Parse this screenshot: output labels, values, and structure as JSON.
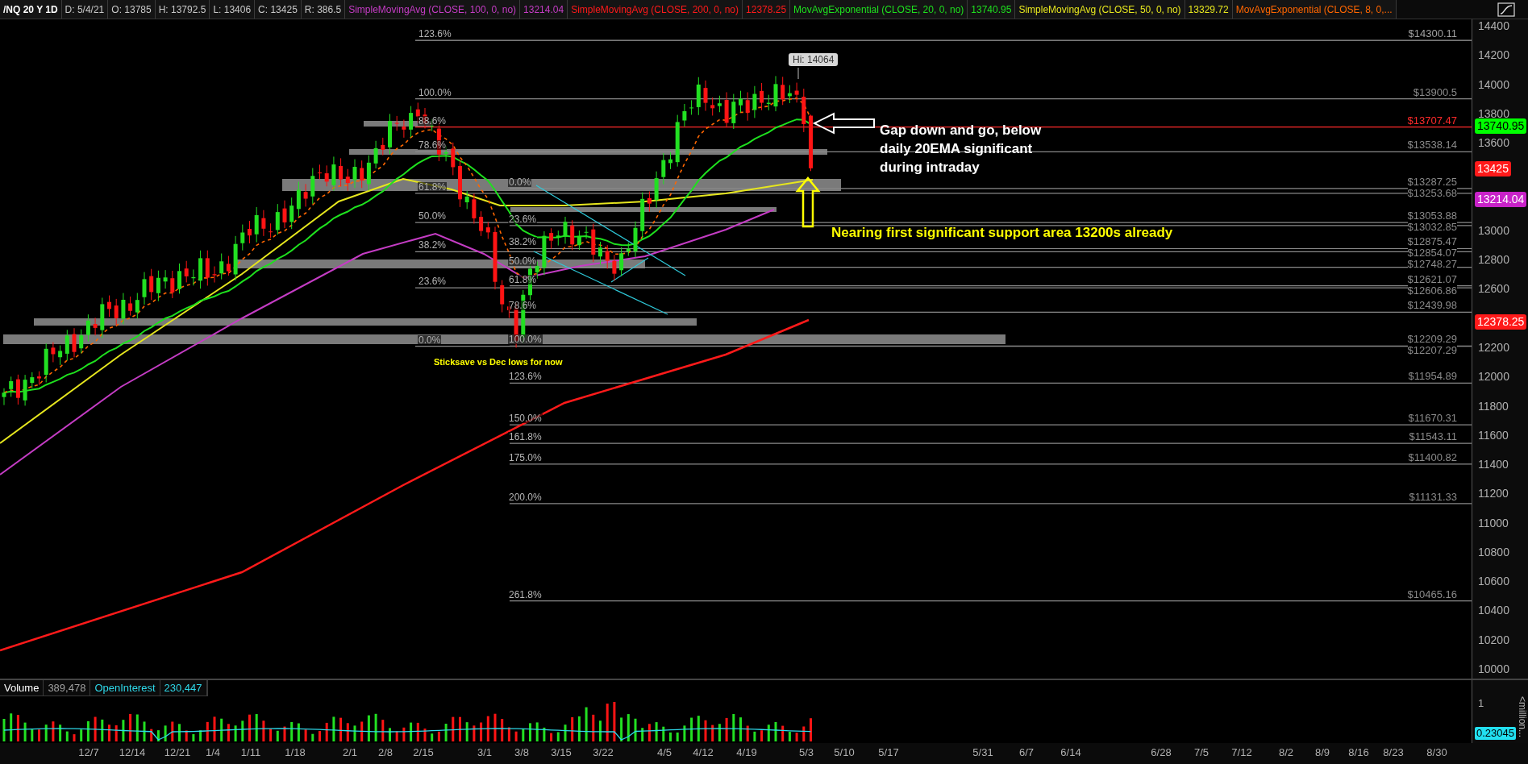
{
  "header": {
    "symbol": "/NQ 20 Y 1D",
    "fields": [
      "D: 5/4/21",
      "O: 13785",
      "H: 13792.5",
      "L: 13406",
      "C: 13425",
      "R: 386.5"
    ],
    "studies": [
      {
        "label": "SimpleMovingAvg (CLOSE, 100, 0, no)",
        "value": "13214.04",
        "color": "#c43cc4"
      },
      {
        "label": "SimpleMovingAvg (CLOSE, 200, 0, no)",
        "value": "12378.25",
        "color": "#ff1a1a"
      },
      {
        "label": "MovAvgExponential (CLOSE, 20, 0, no)",
        "value": "13740.95",
        "color": "#1ee01e"
      },
      {
        "label": "SimpleMovingAvg (CLOSE, 50, 0, no)",
        "value": "13329.72",
        "color": "#e6e61e"
      },
      {
        "label": "MovAvgExponential (CLOSE, 8, 0,...",
        "color": "#ff6600"
      }
    ]
  },
  "price_axis": {
    "ticks": [
      "14400",
      "14200",
      "14000",
      "13800",
      "13600",
      "13000",
      "12800",
      "12600",
      "12200",
      "12000",
      "11800",
      "11600",
      "11400",
      "11200",
      "11000",
      "10800",
      "10600",
      "10400",
      "10200",
      "10000"
    ],
    "badges": [
      {
        "text": "13740.95",
        "color": "#00ff00"
      },
      {
        "text": "13425",
        "color": "#ff1a1a"
      },
      {
        "text": "13214.04",
        "color": "#c822c8"
      },
      {
        "text": "12378.25",
        "color": "#ff1a1a"
      }
    ]
  },
  "fib_sets": [
    {
      "levels": [
        {
          "percent": "123.6%",
          "price": "$14300.11",
          "color": "#a0a0a0"
        },
        {
          "percent": "100.0%",
          "price": "$13900.5",
          "color": "#8a8a8a"
        },
        {
          "percent": "88.6%",
          "price": "$13707.47",
          "color": "#ff2a2a"
        },
        {
          "percent": "78.6%",
          "price": "$13538.14",
          "color": "#8a8a8a"
        },
        {
          "percent": "61.8%",
          "price": "$13253.68",
          "color": "#8a8a8a"
        },
        {
          "percent": "50.0%",
          "price": "$13053.88",
          "color": "#8a8a8a"
        },
        {
          "percent": "38.2%",
          "price": "$12854.07",
          "color": "#8a8a8a"
        },
        {
          "percent": "23.6%",
          "price": "$12606.86",
          "color": "#8a8a8a"
        },
        {
          "percent": "0.0%",
          "price": "$12207.29",
          "color": "#8a8a8a"
        }
      ]
    },
    {
      "levels": [
        {
          "percent": "0.0%",
          "price": "$13287.25",
          "color": "#8a8a8a"
        },
        {
          "percent": "23.6%",
          "price": "$13032.85",
          "color": "#8a8a8a"
        },
        {
          "percent": "38.2%",
          "price": "$12875.47",
          "color": "#8a8a8a"
        },
        {
          "percent": "50.0%",
          "price": "$12748.27",
          "color": "#8a8a8a"
        },
        {
          "percent": "61.8%",
          "price": "$12621.07",
          "color": "#8a8a8a"
        },
        {
          "percent": "78.6%",
          "price": "$12439.98",
          "color": "#8a8a8a"
        },
        {
          "percent": "100.0%",
          "price": "$12209.29",
          "color": "#8a8a8a"
        },
        {
          "percent": "123.6%",
          "price": "$11954.89",
          "color": "#8a8a8a"
        },
        {
          "percent": "150.0%",
          "price": "$11670.31",
          "color": "#8a8a8a"
        },
        {
          "percent": "161.8%",
          "price": "$11543.11",
          "color": "#8a8a8a"
        },
        {
          "percent": "175.0%",
          "price": "$11400.82",
          "color": "#8a8a8a"
        },
        {
          "percent": "200.0%",
          "price": "$11131.33",
          "color": "#8a8a8a"
        },
        {
          "percent": "261.8%",
          "price": "$10465.16",
          "color": "#8a8a8a"
        }
      ]
    }
  ],
  "high_marker": "Hi: 14064",
  "annotations": [
    {
      "kind": "note",
      "text": "Gap down and go, below\ndaily 20EMA significant\nduring intraday"
    },
    {
      "kind": "callout",
      "text": "Nearing first significant support area 13200s already"
    },
    {
      "kind": "small",
      "text": "Sticksave vs Dec lows for now"
    }
  ],
  "volume_panel": {
    "title": "Volume",
    "volume": "389,478",
    "oi_label": "OpenInterest",
    "oi_value": "230,447",
    "scale_tick": "1",
    "badge": "0.23045",
    "unit": "<million..."
  },
  "time_axis": [
    "12/7",
    "12/14",
    "12/21",
    "1/4",
    "1/11",
    "1/18",
    "2/1",
    "2/8",
    "2/15",
    "3/1",
    "3/8",
    "3/15",
    "3/22",
    "4/5",
    "4/12",
    "4/19",
    "5/3",
    "5/10",
    "5/17",
    "5/31",
    "6/7",
    "6/14",
    "6/28",
    "7/5",
    "7/12",
    "8/2",
    "8/9",
    "8/16",
    "8/23",
    "8/30"
  ]
}
